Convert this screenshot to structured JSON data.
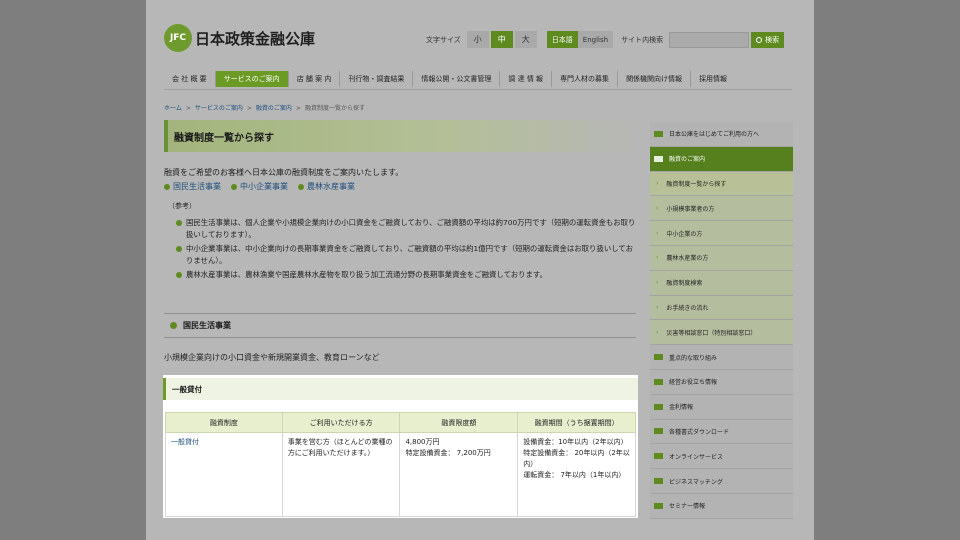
{
  "header": {
    "logo_badge": "JFC",
    "logo_text": "日本政策金融公庫",
    "font_size_label": "文字サイズ",
    "font_sizes": [
      {
        "label": "小",
        "active": false
      },
      {
        "label": "中",
        "active": true
      },
      {
        "label": "大",
        "active": false
      }
    ],
    "lang_ja": "日本語",
    "lang_en": "English",
    "site_search_label": "サイト内検索",
    "search_placeholder": "",
    "search_button": "検索"
  },
  "gnav": [
    {
      "label": "会 社 概 要",
      "active": false
    },
    {
      "label": "サービスのご案内",
      "active": true
    },
    {
      "label": "店 舗 案 内",
      "active": false
    },
    {
      "label": "刊行物・調査結果",
      "active": false
    },
    {
      "label": "情報公開・公文書管理",
      "active": false
    },
    {
      "label": "調 達 情 報",
      "active": false
    },
    {
      "label": "専門人材の募集",
      "active": false
    },
    {
      "label": "関係機関向け情報",
      "active": false
    },
    {
      "label": "採用情報",
      "active": false
    }
  ],
  "breadcrumb": {
    "home": "ホーム",
    "services": "サービスのご案内",
    "loans": "融資のご案内",
    "current": "融資制度一覧から探す"
  },
  "main": {
    "title": "融資制度一覧から探す",
    "intro": "融資をご希望のお客様へ日本公庫の融資制度をご案内いたします。",
    "biz_links": [
      "国民生活事業",
      "中小企業事業",
      "農林水産事業"
    ],
    "ref_head": "（参考）",
    "ref_items": [
      "国民生活事業は、個人企業や小規模企業向けの小口資金をご融資しており、ご融資額の平均は約700万円です（短期の運転資金もお取り扱いしております）。",
      "中小企業事業は、中小企業向けの長期事業資金をご融資しており、ご融資額の平均は約1億円です（短期の運転資金はお取り扱いしておりません）。",
      "農林水産事業は、農林漁業や国産農林水産物を取り扱う加工流通分野の長期事業資金をご融資しております。"
    ],
    "section_title": "国民生活事業",
    "section_desc": "小規模企業向けの小口資金や新規開業資金、教育ローンなど",
    "panel_title": "一般貸付",
    "table": {
      "headers": [
        "融資制度",
        "ご利用いただける方",
        "融資限度額",
        "融資期間（うち据置期間）"
      ],
      "row": {
        "name": "一般貸付",
        "users": "事業を営む方（ほとんどの業種の方にご利用いただけます。）",
        "limit_1": "4,800万円",
        "limit_2": "特定設備資金： 7,200万円",
        "period_1": "設備資金：10年以内（2年以内）",
        "period_2": "特定設備資金： 20年以内（2年以内）",
        "period_3": "運転資金： 7年以内（1年以内）"
      }
    }
  },
  "sidebar": [
    {
      "label": "日本公庫をはじめてご利用の方へ",
      "type": "main"
    },
    {
      "label": "融資のご案内",
      "type": "active"
    },
    {
      "label": "融資制度一覧から探す",
      "type": "sub",
      "current": true
    },
    {
      "label": "小規模事業者の方",
      "type": "sub"
    },
    {
      "label": "中小企業の方",
      "type": "sub"
    },
    {
      "label": "農林水産業の方",
      "type": "sub"
    },
    {
      "label": "融資制度検索",
      "type": "sub"
    },
    {
      "label": "お手続きの流れ",
      "type": "sub"
    },
    {
      "label": "災害等相談窓口（特別相談窓口）",
      "type": "sub"
    },
    {
      "label": "重点的な取り組み",
      "type": "main"
    },
    {
      "label": "経営お役立ち情報",
      "type": "main"
    },
    {
      "label": "金利情報",
      "type": "main"
    },
    {
      "label": "各種書式ダウンロード",
      "type": "main"
    },
    {
      "label": "オンラインサービス",
      "type": "main"
    },
    {
      "label": "ビジネスマッチング",
      "type": "main"
    },
    {
      "label": "セミナー情報",
      "type": "main"
    }
  ],
  "colors": {
    "brand_green": "#5e8a1f",
    "link_blue": "#1d4e7e"
  }
}
